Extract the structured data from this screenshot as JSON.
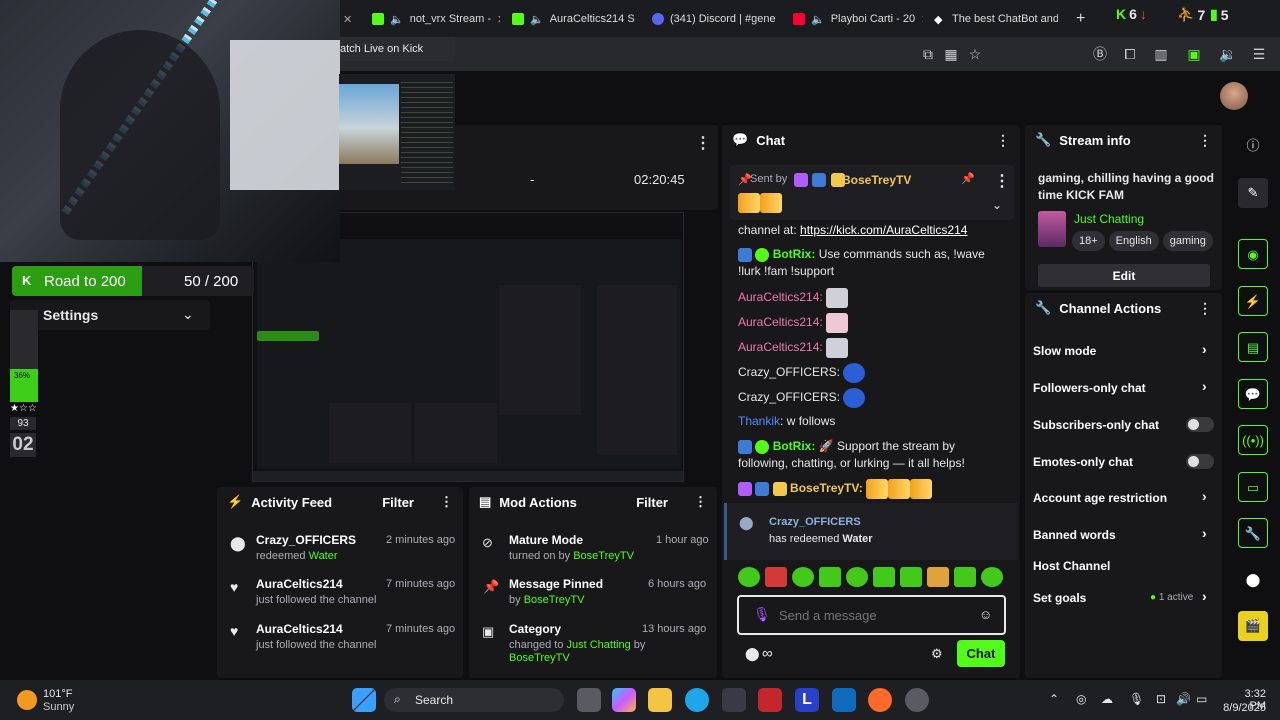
{
  "tabs": [
    {
      "label": "not_vrx Stream -"
    },
    {
      "label": "AuraCeltics214 S"
    },
    {
      "label": "(341) Discord | #gene"
    },
    {
      "label": "Playboi Carti - 20"
    },
    {
      "label": "The best ChatBot and"
    }
  ],
  "browser_stats": {
    "a": "6",
    "b": "7",
    "c": "5"
  },
  "popup_title": "atch Live on Kick",
  "stream_stats": {
    "viewers": "-",
    "uptime": "02:20:45"
  },
  "road": {
    "label": "Road to 200",
    "count": "50 / 200"
  },
  "settings_label": "Settings",
  "meter": {
    "percent": "36%",
    "value": "93",
    "counter": "02",
    "fill": 0.36
  },
  "chat": {
    "title": "Chat",
    "pinned_by_label": "Sent by",
    "pinned_user": "BoseTreyTV",
    "messages": [
      {
        "user": "",
        "text": "channel at: ",
        "link": "https://kick.com/AuraCeltics214"
      },
      {
        "user": "BotRix:",
        "text": " Use commands such as, !wave !lurk !fam !support"
      },
      {
        "user": "AuraCeltics214:",
        "text": ""
      },
      {
        "user": "AuraCeltics214:",
        "text": ""
      },
      {
        "user": "AuraCeltics214:",
        "text": ""
      },
      {
        "user": "Crazy_OFFICERS:",
        "text": ""
      },
      {
        "user": "Crazy_OFFICERS:",
        "text": ""
      },
      {
        "user": "Thankik",
        "text": ": w follows"
      },
      {
        "user": "BotRix:",
        "text": " 🚀 Support the stream by following, chatting, or lurking — it all helps!"
      },
      {
        "user": "BoseTreyTV:",
        "text": ""
      }
    ],
    "redeem": {
      "user": "Crazy_OFFICERS",
      "text": "has redeemed ",
      "item": "Water"
    },
    "input_placeholder": "Send a message",
    "send_label": "Chat"
  },
  "stream_info": {
    "title": "Stream info",
    "stream_title": "gaming, chilling having a good time KICK FAM",
    "category": "Just Chatting",
    "tags": [
      "18+",
      "English",
      "gaming"
    ],
    "edit_label": "Edit"
  },
  "channel_actions": {
    "title": "Channel Actions",
    "items": [
      {
        "label": "Slow mode"
      },
      {
        "label": "Followers-only chat"
      },
      {
        "label": "Subscribers-only chat"
      },
      {
        "label": "Emotes-only chat"
      },
      {
        "label": "Account age restriction"
      },
      {
        "label": "Banned words"
      },
      {
        "label": "Host Channel"
      },
      {
        "label": "Set goals"
      }
    ],
    "goals_status": "1 active"
  },
  "activity_feed": {
    "title": "Activity Feed",
    "filter_label": "Filter",
    "items": [
      {
        "name": "Crazy_OFFICERS",
        "action": "redeemed ",
        "detail": "Water",
        "time": "2 minutes ago"
      },
      {
        "name": "AuraCeltics214",
        "action": "just followed the channel",
        "detail": "",
        "time": "7 minutes ago"
      },
      {
        "name": "AuraCeltics214",
        "action": "just followed the channel",
        "detail": "",
        "time": "7 minutes ago"
      }
    ]
  },
  "mod_actions": {
    "title": "Mod Actions",
    "filter_label": "Filter",
    "items": [
      {
        "name": "Mature Mode",
        "action": "turned on by ",
        "detail": "BoseTreyTV",
        "time": "1 hour ago"
      },
      {
        "name": "Message Pinned",
        "action": "by ",
        "detail": "BoseTreyTV",
        "time": "6 hours ago"
      },
      {
        "name": "Category",
        "action": "changed to ",
        "detail": "Just Chatting",
        "extra": " by",
        "detail2": "BoseTreyTV",
        "time": "13 hours ago"
      }
    ]
  },
  "taskbar": {
    "temp": "101°F",
    "weather": "Sunny",
    "search": "Search",
    "time": "3:32 PM",
    "date": "8/9/2025"
  },
  "colors": {
    "kick_green": "#53fc18",
    "panel": "#18181b",
    "bg": "#0f0f11"
  }
}
